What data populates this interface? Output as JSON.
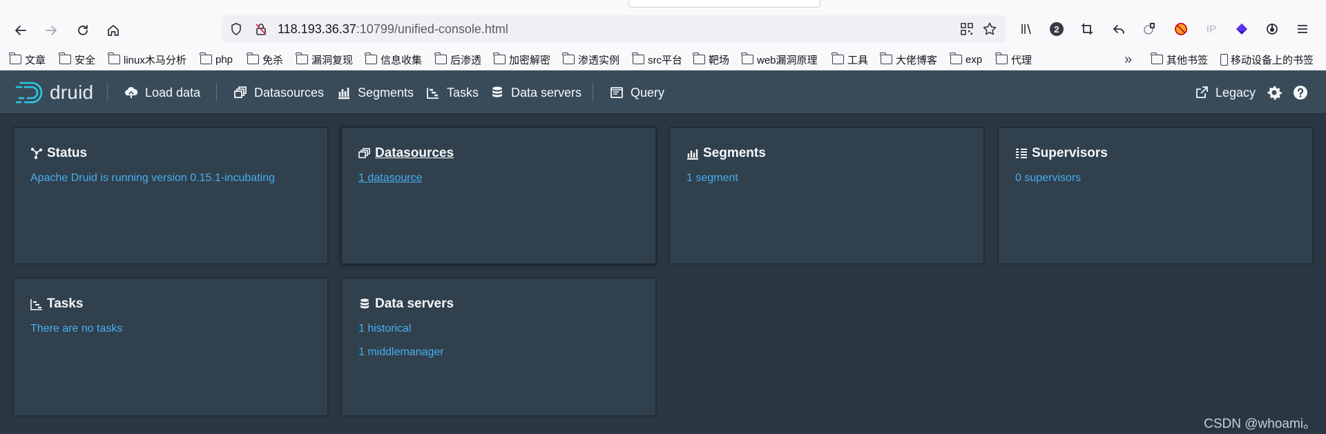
{
  "browser": {
    "url_host": "118.193.36.37",
    "url_rest": ":10799/unified-console.html",
    "toolbar_badge": "2",
    "ip_label": "IP",
    "bookmarks": [
      "文章",
      "安全",
      "linux木马分析",
      "php",
      "免杀",
      "漏洞复现",
      "信息收集",
      "后渗透",
      "加密解密",
      "渗透实例",
      "src平台",
      "靶场",
      "web漏洞原理",
      "工具",
      "大佬博客",
      "exp",
      "代理"
    ],
    "bookmarks_other": "其他书签",
    "bookmarks_mobile": "移动设备上的书签"
  },
  "header": {
    "logo_text": "druid",
    "load_data": "Load data",
    "datasources": "Datasources",
    "segments": "Segments",
    "tasks": "Tasks",
    "data_servers": "Data servers",
    "query": "Query",
    "legacy": "Legacy"
  },
  "cards": {
    "status": {
      "title": "Status",
      "line": "Apache Druid is running version 0.15.1-incubating"
    },
    "datasources": {
      "title": " Datasources",
      "line": "1 datasource"
    },
    "segments": {
      "title": "Segments",
      "line": "1 segment"
    },
    "supervisors": {
      "title": "Supervisors",
      "line": "0 supervisors"
    },
    "tasks": {
      "title": "Tasks",
      "line": "There are no tasks"
    },
    "data_servers": {
      "title": "Data servers",
      "line1": "1 historical",
      "line2": "1 middlemanager"
    }
  },
  "watermark": "CSDN @whoami。",
  "colors": {
    "header_bg": "#394b59",
    "page_bg": "#293742",
    "card_bg": "#30404d",
    "link": "#48aff0"
  }
}
